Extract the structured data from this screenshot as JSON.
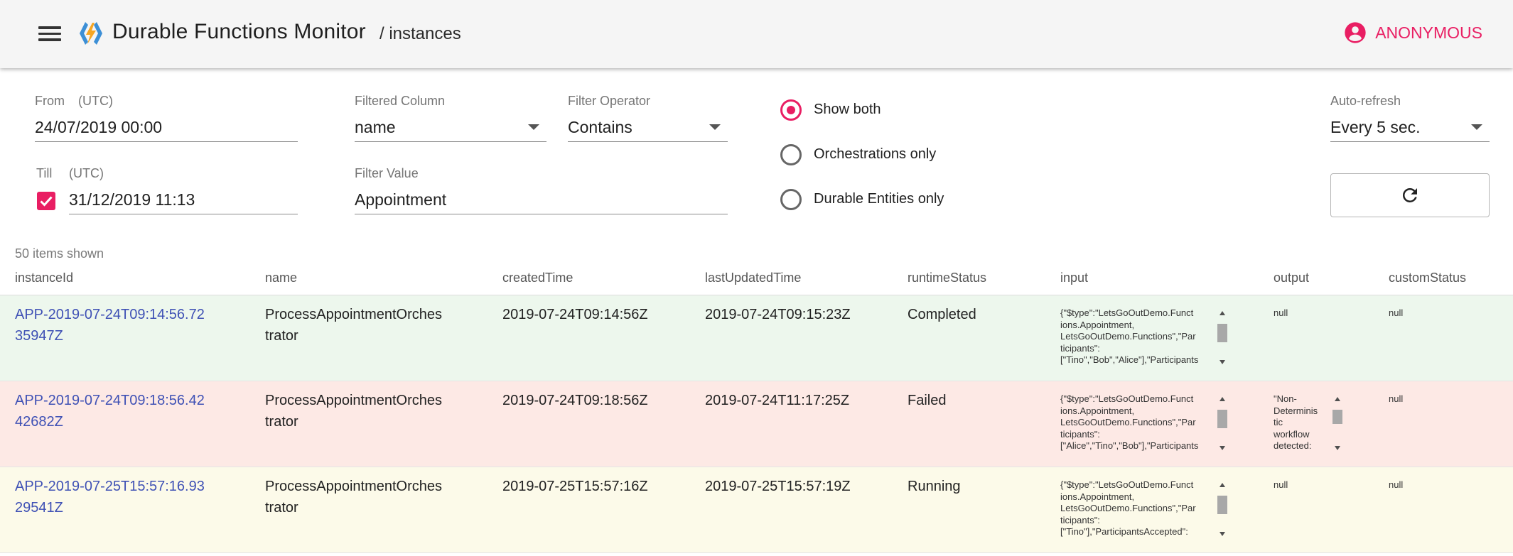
{
  "header": {
    "menu_icon": "hamburger-menu-icon",
    "logo_icon": "azure-functions-logo",
    "title": "Durable Functions Monitor",
    "breadcrumb": "/ instances",
    "user_icon": "account-circle-icon",
    "user_label": "ANONYMOUS",
    "accent_color": "#e91e63"
  },
  "filters": {
    "from": {
      "label": "From",
      "tz": "(UTC)",
      "value": "24/07/2019 00:00"
    },
    "till": {
      "label": "Till",
      "tz": "(UTC)",
      "value": "31/12/2019 11:13",
      "checked": true
    },
    "filtered_column": {
      "label": "Filtered Column",
      "value": "name"
    },
    "filter_operator": {
      "label": "Filter Operator",
      "value": "Contains"
    },
    "filter_value": {
      "label": "Filter Value",
      "value": "Appointment"
    },
    "type_options": [
      {
        "label": "Show both",
        "selected": true
      },
      {
        "label": "Orchestrations only",
        "selected": false
      },
      {
        "label": "Durable Entities only",
        "selected": false
      }
    ],
    "auto_refresh": {
      "label": "Auto-refresh",
      "value": "Every 5 sec."
    },
    "refresh_icon": "refresh-icon"
  },
  "table": {
    "items_shown": "50 items shown",
    "columns": [
      "instanceId",
      "name",
      "createdTime",
      "lastUpdatedTime",
      "runtimeStatus",
      "input",
      "output",
      "customStatus"
    ],
    "status_colors": {
      "Completed": "#edf7ed",
      "Failed": "#fde9e5",
      "Running": "#fcfae9"
    },
    "link_color": "#3f51b5",
    "rows": [
      {
        "instance_id_lines": [
          "APP-2019-07-24T09:14:56.72",
          "35947Z"
        ],
        "name_lines": [
          "ProcessAppointmentOrches",
          "trator"
        ],
        "created": "2019-07-24T09:14:56Z",
        "updated": "2019-07-24T09:15:23Z",
        "status": "Completed",
        "input_lines": [
          "{\"$type\":\"LetsGoOutDemo.Funct",
          "ions.Appointment,",
          "LetsGoOutDemo.Functions\",\"Par",
          "ticipants\":",
          "[\"Tino\",\"Bob\",\"Alice\"],\"Participants"
        ],
        "output_lines": [
          "null"
        ],
        "custom_status": "null"
      },
      {
        "instance_id_lines": [
          "APP-2019-07-24T09:18:56.42",
          "42682Z"
        ],
        "name_lines": [
          "ProcessAppointmentOrches",
          "trator"
        ],
        "created": "2019-07-24T09:18:56Z",
        "updated": "2019-07-24T11:17:25Z",
        "status": "Failed",
        "input_lines": [
          "{\"$type\":\"LetsGoOutDemo.Funct",
          "ions.Appointment,",
          "LetsGoOutDemo.Functions\",\"Par",
          "ticipants\":",
          "[\"Alice\",\"Tino\",\"Bob\"],\"Participants"
        ],
        "output_lines": [
          "\"Non-",
          "Determinis",
          "tic",
          "workflow",
          "detected:"
        ],
        "custom_status": "null"
      },
      {
        "instance_id_lines": [
          "APP-2019-07-25T15:57:16.93",
          "29541Z"
        ],
        "name_lines": [
          "ProcessAppointmentOrches",
          "trator"
        ],
        "created": "2019-07-25T15:57:16Z",
        "updated": "2019-07-25T15:57:19Z",
        "status": "Running",
        "input_lines": [
          "{\"$type\":\"LetsGoOutDemo.Funct",
          "ions.Appointment,",
          "LetsGoOutDemo.Functions\",\"Par",
          "ticipants\":",
          "[\"Tino\"],\"ParticipantsAccepted\":"
        ],
        "output_lines": [
          "null"
        ],
        "custom_status": "null"
      }
    ]
  }
}
